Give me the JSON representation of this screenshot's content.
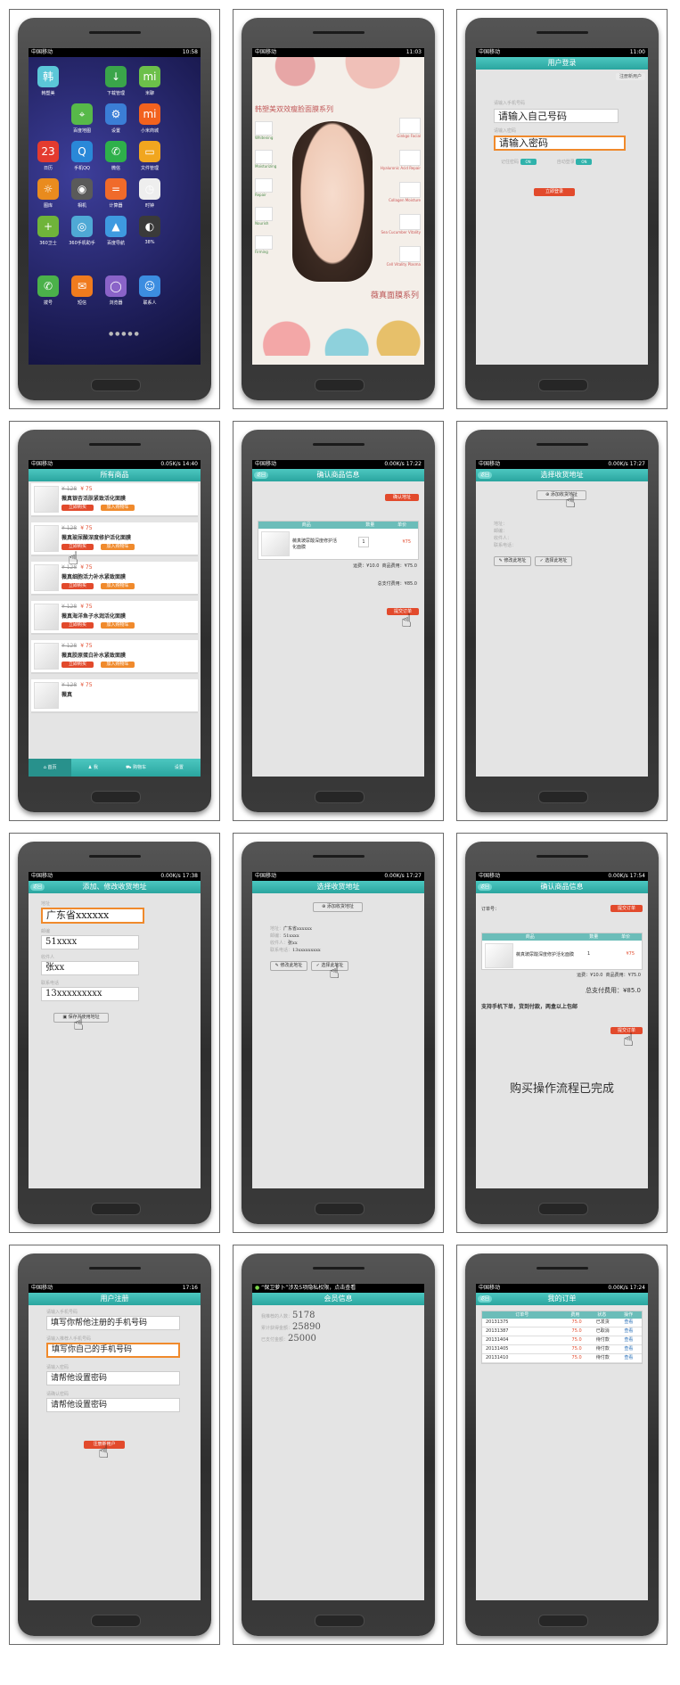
{
  "status": {
    "carrier": "中国移动",
    "times": [
      "10:58",
      "11:03",
      "11:00",
      "14:40",
      "17:22",
      "17:27",
      "17:38",
      "17:27",
      "17:54",
      "17:16",
      "17:24"
    ],
    "speed": "0.00K/s",
    "speed2": "0.05K/s"
  },
  "colors": {
    "accent": "#2fb2ab",
    "red": "#e24a2c",
    "orange": "#f08a2c"
  },
  "icons": {
    "home": [
      {
        "label": "韩塑美",
        "color": "#5bc7d8",
        "glyph": "韩"
      },
      {
        "label": "下载管理",
        "color": "#3aa54a",
        "glyph": "↓"
      },
      {
        "label": "米聊",
        "color": "#6cc04a",
        "glyph": "mi"
      },
      {
        "label": "百度地图",
        "color": "#57b949",
        "glyph": "⌖"
      },
      {
        "label": "设置",
        "color": "#3b7ed6",
        "glyph": "⚙"
      },
      {
        "label": "小米商城",
        "color": "#f2621e",
        "glyph": "mi"
      },
      {
        "label": "日历",
        "color": "#e43b2f",
        "glyph": "23"
      },
      {
        "label": "手机QQ",
        "color": "#2a88d8",
        "glyph": "Q"
      },
      {
        "label": "微信",
        "color": "#2eb04a",
        "glyph": "✆"
      },
      {
        "label": "文件管理",
        "color": "#f1a61f",
        "glyph": "▭"
      },
      {
        "label": "图库",
        "color": "#e98b1e",
        "glyph": "☼"
      },
      {
        "label": "相机",
        "color": "#5a5a5a",
        "glyph": "◉"
      },
      {
        "label": "计算器",
        "color": "#f06a2a",
        "glyph": "="
      },
      {
        "label": "时钟",
        "color": "#eeeeee",
        "glyph": "◷"
      },
      {
        "label": "360卫士",
        "color": "#6fb43a",
        "glyph": "+"
      },
      {
        "label": "360手机助手",
        "color": "#4fa9d5",
        "glyph": "◎"
      },
      {
        "label": "百度导航",
        "color": "#3e9ae0",
        "glyph": "▲"
      },
      {
        "label": "38%",
        "color": "#3a3a3a",
        "glyph": "◐"
      }
    ],
    "dock": [
      {
        "label": "拨号",
        "color": "#4bb14a",
        "glyph": "✆"
      },
      {
        "label": "短信",
        "color": "#f07b1e",
        "glyph": "✉"
      },
      {
        "label": "浏览器",
        "color": "#8a63c8",
        "glyph": "◯"
      },
      {
        "label": "联系人",
        "color": "#3c8de0",
        "glyph": "☺"
      }
    ]
  },
  "poster": {
    "title": "韩塑美双效瘦脸面膜系列",
    "footer": "薇真面膜系列",
    "items": [
      "Ginkgo Facial",
      "Hyaluronic Acid Repair",
      "Collagen Moisture",
      "Sea Cucumber Vitality",
      "Cell Vitality Plasma"
    ],
    "left": [
      "Whitening",
      "Moisturizing",
      "Repair",
      "Nourish",
      "Firming"
    ]
  },
  "login": {
    "title": "用户登录",
    "register_btn": "注册新用户",
    "phone_label": "请输入手机号码",
    "phone_value": "请输入自己号码",
    "pwd_label": "请输入密码",
    "pwd_value": "请输入密码",
    "remember": "记住密码",
    "auto": "自动登录",
    "on": "ON",
    "login_btn": "立即登录"
  },
  "products": {
    "title": "所有商品",
    "old_price": "¥ 128",
    "new_price": "¥ 75",
    "buy": "立即购买",
    "cart": "加入购物车",
    "items": [
      "薇真银杏活肤紧致活化面膜",
      "薇真玻尿酸深度修护活化面膜",
      "薇真细胞活力补水紧致面膜",
      "薇真海洋鱼子水润活化面膜",
      "薇真胶原蛋白补水紧致面膜",
      "薇真"
    ],
    "nav": [
      "首页",
      "我",
      "购物车",
      "设置"
    ]
  },
  "confirm": {
    "title": "确认商品信息",
    "back": "返回",
    "addr_btn": "确认地址",
    "cols": [
      "商品",
      "数量",
      "单价"
    ],
    "product": "薇真玻尿酸深度修护活化面膜",
    "qty": "1",
    "price": "¥75",
    "shipping": "运费：¥10.0",
    "goods_fee": "商品费用：¥75.0",
    "total": "总支付费用：¥85.0",
    "submit": "提交订单",
    "order_no": "订单号：",
    "note": "支持手机下单，货到付款，两盒以上包邮",
    "done": "购买操作流程已完成"
  },
  "address": {
    "title": "选择收货地址",
    "add_btn": "添加收货地址",
    "edit_btn": "修改此地址",
    "select_btn": "选择此地址",
    "f_addr": "地址：",
    "f_zip": "邮编：",
    "f_name": "收件人：",
    "f_phone": "联系电话：",
    "v_addr": "广东省xxxxxx",
    "v_zip": "51xxxx",
    "v_name": "张xx",
    "v_phone": "13xxxxxxxxx"
  },
  "edit": {
    "title": "添加、修改收货地址",
    "l_addr": "地址",
    "l_zip": "邮编",
    "l_name": "收件人",
    "l_phone": "联系电话",
    "v_addr": "广东省xxxxxx",
    "v_zip": "51xxxx",
    "v_name": "张xx",
    "v_phone": "13xxxxxxxxx",
    "save": "保存并使用地址"
  },
  "register": {
    "title": "用户注册",
    "l1": "请输入手机号码",
    "v1": "填写你帮他注册的手机号码",
    "l2": "请输入推荐人手机号码",
    "v2": "填写你自己的手机号码",
    "l3": "请输入密码",
    "v3": "请帮他设置密码",
    "l4": "请确认密码",
    "v4": "请帮他设置密码",
    "btn": "注册新用户"
  },
  "member": {
    "notice": "“保卫萝卜”涉及5项隐私权限，点击查看",
    "title": "会员信息",
    "l1": "我推荐的人数：",
    "v1": "5178",
    "l2": "累计获得金额：",
    "v2": "25890",
    "l3": "已支付金额：",
    "v3": "25000"
  },
  "orders": {
    "title": "我的订单",
    "cols": [
      "订单号",
      "费用",
      "状态",
      "操作"
    ],
    "rows": [
      {
        "no": "20131375",
        "fee": "75.0",
        "state": "已发货",
        "op": "查看"
      },
      {
        "no": "20131387",
        "fee": "75.0",
        "state": "已取消",
        "op": "查看"
      },
      {
        "no": "20131404",
        "fee": "75.0",
        "state": "待付款",
        "op": "查看"
      },
      {
        "no": "20131405",
        "fee": "75.0",
        "state": "待付款",
        "op": "查看"
      },
      {
        "no": "20131410",
        "fee": "75.0",
        "state": "待付款",
        "op": "查看"
      }
    ]
  }
}
